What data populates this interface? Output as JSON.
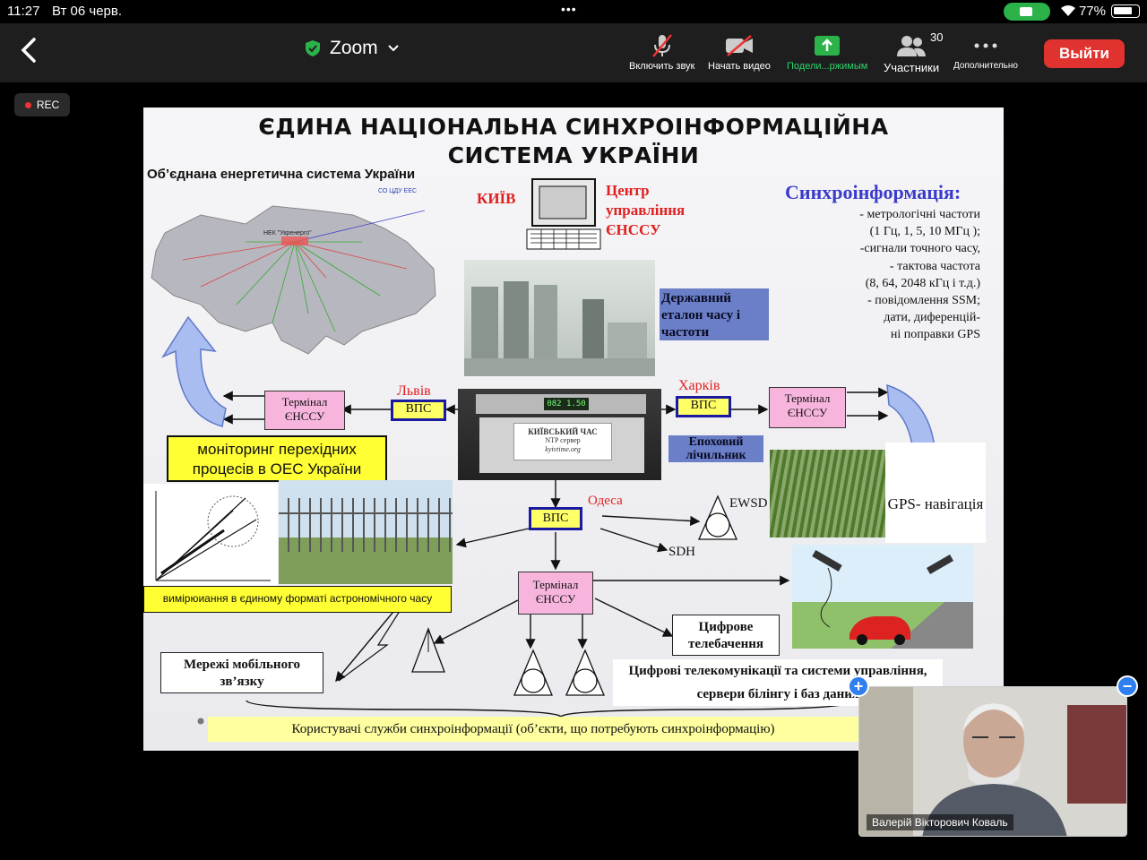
{
  "status": {
    "time": "11:27",
    "date": "Вт 06 черв.",
    "battery": "77%",
    "dots": "•••"
  },
  "toolbar": {
    "app_title": "Zoom",
    "unmute_label": "Включить звук",
    "video_label": "Начать видео",
    "share_label": "Подели...ржимым",
    "participants_label": "Участники",
    "participants_count": "30",
    "more_label": "Дополнительно",
    "exit_label": "Выйти",
    "accent_green": "#2bb34a",
    "exit_color": "#e0322f"
  },
  "rec_label": "REC",
  "slide": {
    "title_line1": "ЄДИНА НАЦІОНАЛЬНА СИНХРОІНФОРМАЦІЙНА",
    "title_line2": "СИСТЕМА УКРАЇНИ",
    "map_caption": "Об’єднана енергетична система України",
    "map_sub": "СО ЦДУ ЕЕС",
    "map_center": "НЕК \"Укренерго\"",
    "kyiv": "КИЇВ",
    "center_line1": "Центр",
    "center_line2": "управління",
    "center_line3": "ЄНССУ",
    "sync_title": "Синхроінформація:",
    "sync_items": [
      "- метрологічні частоти",
      "(1 Гц, 1, 5, 10 МГц );",
      "-сигнали точного часу,",
      "- тактова частота",
      "(8, 64, 2048 кГц і т.д.)",
      "- повідомлення SSM;",
      "дати, диференцій-",
      "ні поправки GPS"
    ],
    "etalon": "Державний еталон часу і частоти",
    "lviv": "Львів",
    "kharkiv": "Харків",
    "odesa": "Одеса",
    "vps": "ВПС",
    "terminal": "Термінал ЄНССУ",
    "kyiv_time": "КИЇВСЬКИЙ ЧАС",
    "ntp": "NTP сервер",
    "ntp_site": "kyivtime.org",
    "display_value": "082 1.50",
    "epoch": "Епоховий лічильник",
    "monitoring": "моніторинг перехідних процесів в ОЕС України",
    "measuring": "вимірюиання в єдиному форматі астрономічного часу",
    "gps": "GPS- навігація",
    "ewsd": "EWSD",
    "sdh": "SDH",
    "digital_tv": "Цифрове телебачення",
    "mobile": "Мережі мобільного зв’язку",
    "telecom_line1": "Цифрові телекомунікації та системи управління,",
    "telecom_line2": "сервери білінгу і баз даних",
    "users": "Користувачі служби синхроінформації  (об’єкти, що потребують синхроінформацію)"
  },
  "video": {
    "name": "Валерій Вікторович Коваль"
  }
}
